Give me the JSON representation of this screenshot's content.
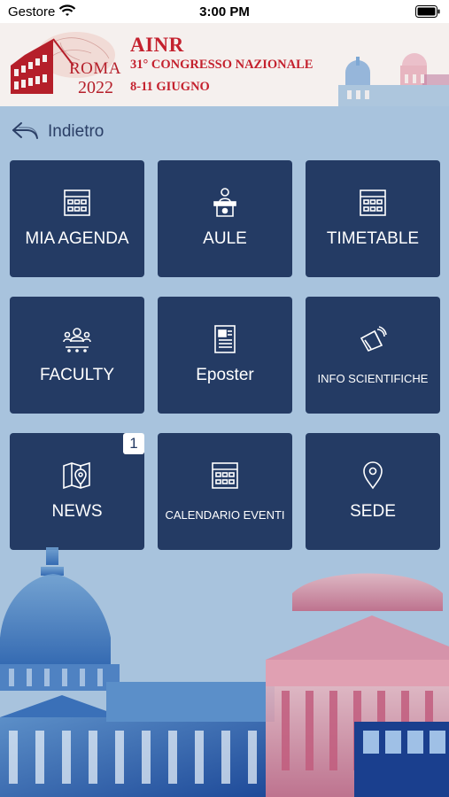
{
  "status_bar": {
    "carrier": "Gestore",
    "time": "3:00 PM"
  },
  "banner": {
    "org": "AINR",
    "congress": "31° CONGRESSO NAZIONALE",
    "dates": "8-11 GIUGNO",
    "city": "ROMA",
    "year": "2022"
  },
  "nav": {
    "back_label": "Indietro"
  },
  "tiles": [
    {
      "label": "MIA AGENDA",
      "icon": "calendar-icon"
    },
    {
      "label": "AULE",
      "icon": "podium-icon"
    },
    {
      "label": "TIMETABLE",
      "icon": "calendar-icon"
    },
    {
      "label": "FACULTY",
      "icon": "faculty-icon"
    },
    {
      "label": "Eposter",
      "icon": "document-icon"
    },
    {
      "label": "INFO SCIENTIFICHE",
      "icon": "info-scientific-icon"
    },
    {
      "label": "NEWS",
      "icon": "map-pin-icon",
      "badge": "1"
    },
    {
      "label": "CALENDARIO EVENTI",
      "icon": "calendar-icon"
    },
    {
      "label": "SEDE",
      "icon": "location-pin-icon"
    }
  ],
  "colors": {
    "tile_bg": "#243b64",
    "background": "#a8c3dd",
    "brand_red": "#c4212e"
  }
}
